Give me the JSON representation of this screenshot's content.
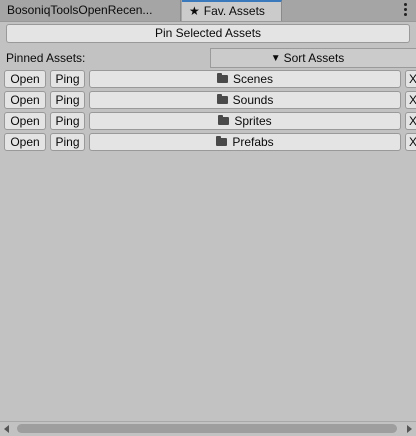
{
  "tabs": [
    {
      "label": "BosoniqToolsOpenRecen...",
      "active": false
    },
    {
      "label": "Fav. Assets",
      "icon": "star-icon",
      "active": true
    }
  ],
  "toolbar": {
    "pin_label": "Pin Selected Assets"
  },
  "header": {
    "label": "Pinned Assets:",
    "sort_label": "Sort Assets"
  },
  "assets": [
    {
      "open": "Open",
      "ping": "Ping",
      "name": "Scenes",
      "remove": "X"
    },
    {
      "open": "Open",
      "ping": "Ping",
      "name": "Sounds",
      "remove": "X"
    },
    {
      "open": "Open",
      "ping": "Ping",
      "name": "Sprites",
      "remove": "X"
    },
    {
      "open": "Open",
      "ping": "Ping",
      "name": "Prefabs",
      "remove": "X"
    }
  ],
  "colors": {
    "background": "#c2c2c2",
    "tabbar": "#a5a5a5",
    "active_tab_accent": "#3a79bb",
    "button": "#e4e4e4"
  }
}
